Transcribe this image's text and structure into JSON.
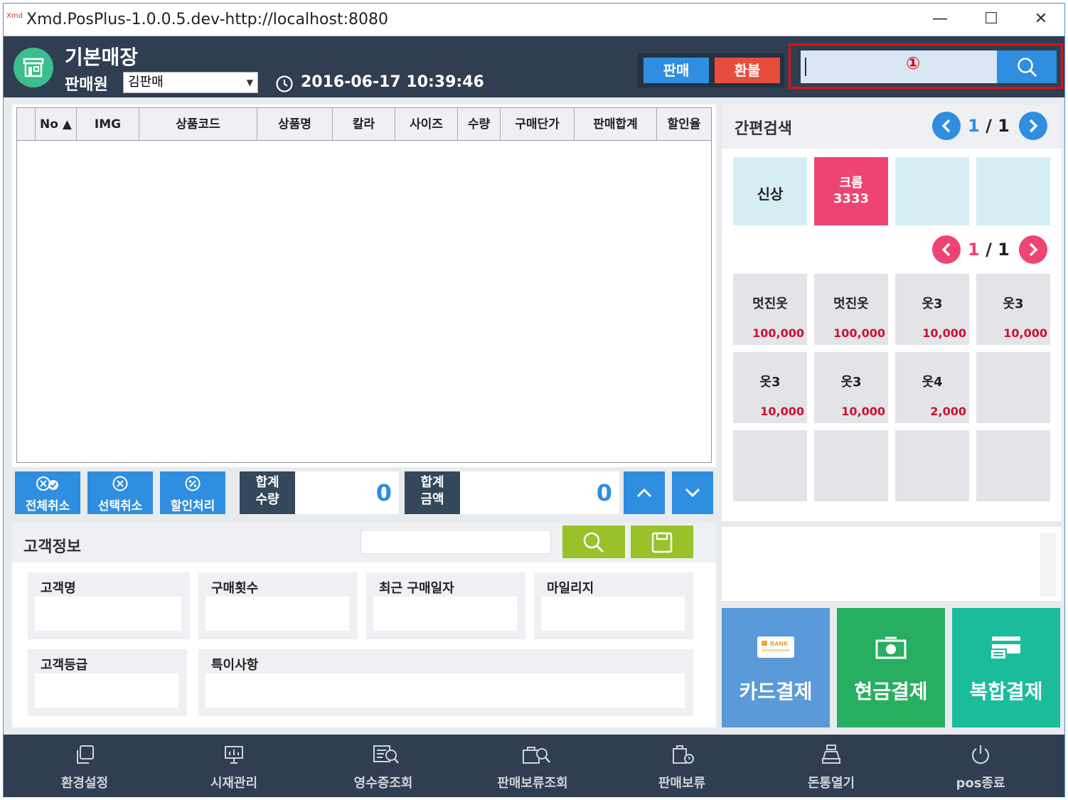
{
  "window": {
    "title": "Xmd.PosPlus-1.0.0.5.dev-http://localhost:8080",
    "app_icon_text": "Xmd",
    "minimize": "—",
    "maximize": "☐",
    "close": "✕"
  },
  "header": {
    "store_name": "기본매장",
    "seller_label": "판매원",
    "seller_value": "김판매",
    "datetime": "2016-06-17 10:39:46",
    "sale_button": "판매",
    "refund_button": "환불",
    "search_value": "",
    "annotation_marker": "①"
  },
  "colors": {
    "header_bg": "#2f3e50",
    "accent_blue": "#2f8ee0",
    "refund_red": "#e84c3d",
    "store_icon_green": "#3bbd8c",
    "customer_green": "#98c22a",
    "card_pay": "#5a9ad8",
    "cash_pay": "#27ae60",
    "mixed_pay": "#1abc9c",
    "category_pink": "#ee4473",
    "price_red": "#cc1133",
    "annotation_red": "#e01010"
  },
  "grid": {
    "columns": [
      "No ▲",
      "IMG",
      "상품코드",
      "상품명",
      "칼라",
      "사이즈",
      "수량",
      "구매단가",
      "판매합계",
      "할인율"
    ],
    "rows": []
  },
  "actions": {
    "cancel_all": "전체취소",
    "cancel_selected": "선택취소",
    "discount": "할인처리"
  },
  "totals": {
    "qty_label_1": "합계",
    "qty_label_2": "수량",
    "qty_value": "0",
    "amount_label_1": "합계",
    "amount_label_2": "금액",
    "amount_value": "0"
  },
  "customer": {
    "title": "고객정보",
    "search_value": "",
    "fields": {
      "name": "고객명",
      "purchase_count": "구매횟수",
      "last_purchase": "최근 구매일자",
      "mileage": "마일리지",
      "grade": "고객등급",
      "notes": "특이사항"
    }
  },
  "quick_search": {
    "title": "간편검색",
    "category_page": "1",
    "category_total": "/ 1",
    "product_page": "1",
    "product_total": "/ 1",
    "categories": [
      {
        "label": "신상",
        "sub": ""
      },
      {
        "label": "크롬",
        "sub": "3333"
      },
      {
        "label": "",
        "sub": ""
      },
      {
        "label": "",
        "sub": ""
      }
    ],
    "products": [
      {
        "name": "멋진옷",
        "price": "100,000"
      },
      {
        "name": "멋진옷",
        "price": "100,000"
      },
      {
        "name": "옷3",
        "price": "10,000"
      },
      {
        "name": "옷3",
        "price": "10,000"
      },
      {
        "name": "옷3",
        "price": "10,000"
      },
      {
        "name": "옷3",
        "price": "10,000"
      },
      {
        "name": "옷4",
        "price": "2,000"
      },
      {
        "name": "",
        "price": ""
      },
      {
        "name": "",
        "price": ""
      },
      {
        "name": "",
        "price": ""
      },
      {
        "name": "",
        "price": ""
      },
      {
        "name": "",
        "price": ""
      }
    ]
  },
  "payment": {
    "card": "카드결제",
    "cash": "현금결제",
    "mixed": "복합결제",
    "card_icon_text": "BANK"
  },
  "footer": [
    {
      "label": "환경설정",
      "icon": "copy-icon"
    },
    {
      "label": "시재관리",
      "icon": "presentation-icon"
    },
    {
      "label": "영수증조회",
      "icon": "receipt-search-icon"
    },
    {
      "label": "판매보류조회",
      "icon": "hold-search-icon"
    },
    {
      "label": "판매보류",
      "icon": "bag-clock-icon"
    },
    {
      "label": "돈통열기",
      "icon": "cash-register-icon"
    },
    {
      "label": "pos종료",
      "icon": "power-icon"
    }
  ]
}
